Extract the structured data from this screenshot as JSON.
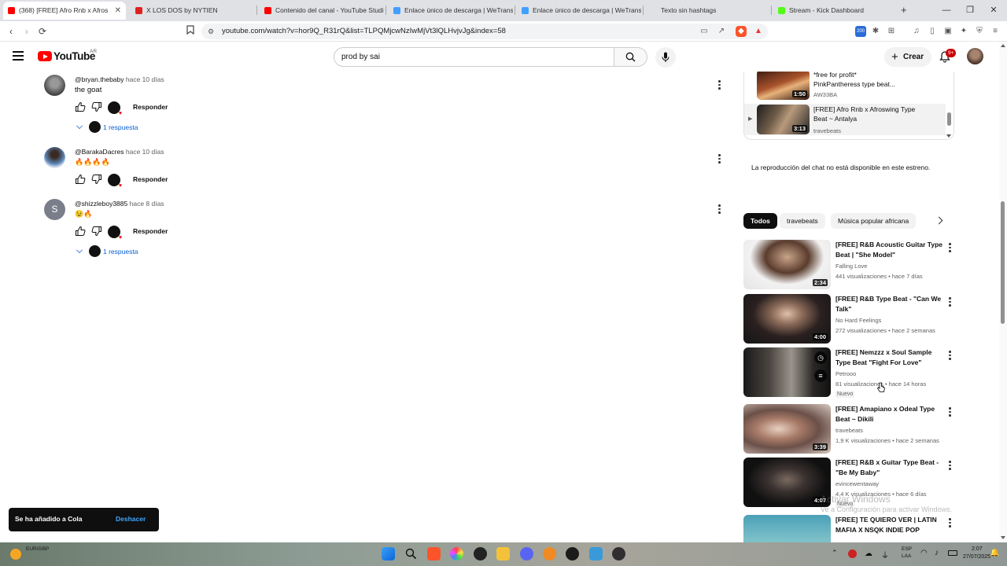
{
  "browser": {
    "tabs": [
      {
        "title": "(368) [FREE] Afro Rnb x Afros",
        "active": true,
        "favicon_color": "#ff0000"
      },
      {
        "title": "X LOS DOS by NYTIEN",
        "active": false,
        "favicon_color": "#e02020"
      },
      {
        "title": "Contenido del canal - YouTube Studi",
        "active": false,
        "favicon_color": "#ff0000"
      },
      {
        "title": "Enlace único de descarga | WeTransf",
        "active": false,
        "favicon_color": "#409fff"
      },
      {
        "title": "Enlace único de descarga | WeTransf",
        "active": false,
        "favicon_color": "#409fff"
      },
      {
        "title": "Texto sin hashtags",
        "active": false,
        "favicon_color": "#888888"
      },
      {
        "title": "Stream - Kick Dashboard",
        "active": false,
        "favicon_color": "#53fc18"
      }
    ],
    "new_tab": "+",
    "url": "youtube.com/watch?v=hor9Q_R31rQ&list=TLPQMjcwNzIwMjVt3lQLHvjvJg&index=58",
    "extension_badge": "200"
  },
  "youtube": {
    "logo_text": "YouTube",
    "country": "AR",
    "search_value": "prod by sai",
    "create_label": "Crear",
    "notification_count": "9+"
  },
  "comments": [
    {
      "author": "@bryan.thebaby",
      "time": "hace 10 días",
      "text": "the goat",
      "reply_label": "Responder",
      "replies": "1 respuesta",
      "avatar_color": "#6b6b6b"
    },
    {
      "author": "@BarakaDacres",
      "time": "hace 10 días",
      "text": "🔥🔥🔥🔥",
      "reply_label": "Responder",
      "replies": "",
      "avatar_color": "#2f4b7a"
    },
    {
      "author": "@shizzleboy3885",
      "time": "hace 8 días",
      "text": "😉🔥",
      "reply_label": "Responder",
      "replies": "1 respuesta",
      "avatar_color": "#7a7d8a",
      "avatar_letter": "S"
    }
  ],
  "playlist": [
    {
      "title_line1": "*free for profit*",
      "title_line2": "PinkPantheress type beat...",
      "channel": "AW33BA",
      "duration": "1:50",
      "active": false
    },
    {
      "title_line1": "[FREE] Afro Rnb x Afroswing Type",
      "title_line2": "Beat ~ Antalya",
      "channel": "travebeats",
      "duration": "3:13",
      "active": true
    }
  ],
  "chat_message": "La reproducción del chat no está disponible en este estreno.",
  "chips": [
    "Todos",
    "travebeats",
    "Música popular africana"
  ],
  "recommendations": [
    {
      "title": "[FREE] R&B Acoustic Guitar Type Beat | \"She Model\"",
      "channel": "Falling Love",
      "meta": "441 visualizaciones • hace 7 días",
      "duration": "2:34",
      "badge": ""
    },
    {
      "title": "[FREE] R&B Type Beat - \"Can We Talk\"",
      "channel": "No Hard Feelings",
      "meta": "272 visualizaciones • hace 2 semanas",
      "duration": "4:00",
      "badge": ""
    },
    {
      "title": "[FREE] Nemzzz x Soul Sample Type Beat \"Fight For Love\"",
      "channel": "Petrooo",
      "meta": "81 visualizaciones • hace 14 horas",
      "duration": "",
      "badge": "Nuevo"
    },
    {
      "title": "[FREE] Amapiano x Odeal Type Beat ~ Dikili",
      "channel": "travebeats",
      "meta": "1,9 K visualizaciones • hace 2 semanas",
      "duration": "3:39",
      "badge": ""
    },
    {
      "title": "[FREE] R&B x Guitar Type Beat - \"Be My Baby\"",
      "channel": "evincewentaway",
      "meta": "4,4 K visualizaciones • hace 6 días",
      "duration": "4:07",
      "badge": "Nuevo"
    },
    {
      "title": "[FREE] TE QUIERO VER | LATIN MAFIA X NSQK INDIE POP",
      "channel": "",
      "meta": "",
      "duration": "",
      "badge": ""
    }
  ],
  "toast": {
    "message": "Se ha añadido a Cola",
    "action": "Deshacer"
  },
  "watermark": {
    "line1": "Activar Windows",
    "line2": "Ve a Configuración para activar Windows."
  },
  "taskbar": {
    "weather_line1": "EUR/GBP",
    "weather_line2": "",
    "lang_line1": "ESP",
    "lang_line2": "LAA",
    "time": "2:07",
    "date": "27/07/2025"
  }
}
